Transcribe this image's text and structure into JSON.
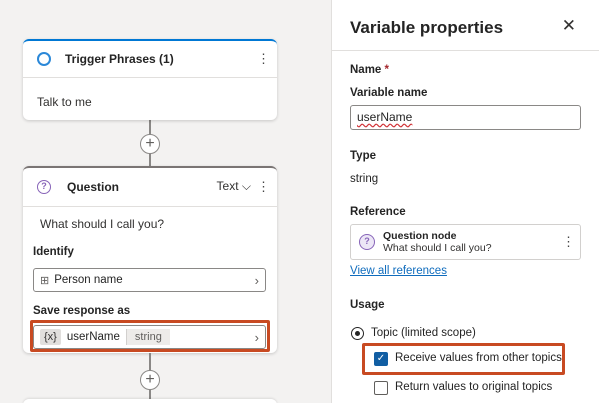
{
  "canvas": {
    "trigger": {
      "title": "Trigger Phrases (1)",
      "text": "Talk to me",
      "icon": "lightbulb-icon"
    },
    "question": {
      "title": "Question",
      "type": "Text",
      "prompt": "What should I call you?",
      "identify_label": "Identify",
      "identify_value": "Person name",
      "save_label": "Save response as",
      "var_symbol": "{x}",
      "var_name": "userName",
      "var_type": "string"
    },
    "add_symbol": "+"
  },
  "panel": {
    "title": "Variable properties",
    "close": "✕",
    "name_label": "Name",
    "required_mark": "*",
    "variable_name_label": "Variable name",
    "variable_name_value": "userName",
    "type_label": "Type",
    "type_value": "string",
    "reference_label": "Reference",
    "reference_node_title": "Question node",
    "reference_node_text": "What should I call you?",
    "view_all_link": "View all references",
    "usage_label": "Usage",
    "scope_option": "Topic (limited scope)",
    "receive_option": "Receive values from other topics",
    "receive_checked": true,
    "return_option": "Return values to original topics",
    "return_checked": false
  },
  "colors": {
    "accent": "#0078d4",
    "highlight": "#c84a22",
    "checkbox": "#115ea3",
    "link": "#0f6cbd"
  }
}
